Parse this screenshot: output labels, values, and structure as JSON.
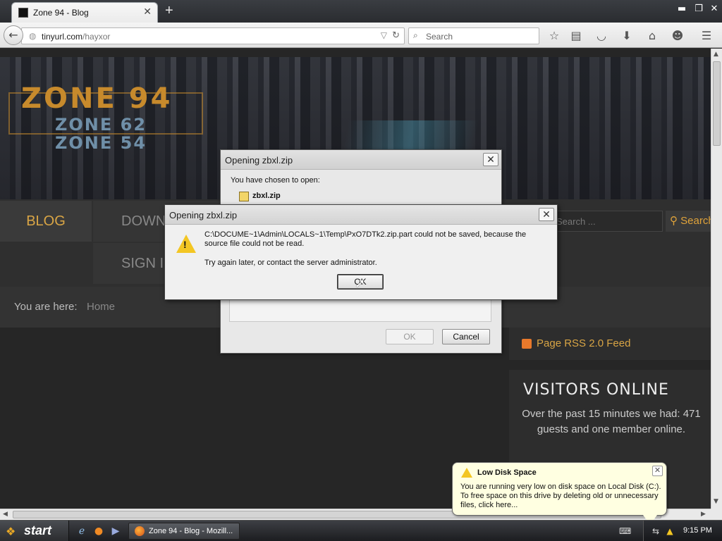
{
  "browser": {
    "tab_title": "Zone 94 - Blog",
    "tab_close": "✕",
    "new_tab": "+",
    "window_controls": {
      "minimize": "▬",
      "maximize": "❐",
      "close": "✕"
    },
    "back": "←",
    "url_host": "tinyurl.com",
    "url_path": "/hayxor",
    "search_placeholder": "Search",
    "toolbar_icons": [
      "star-icon",
      "reading-list-icon",
      "pocket-icon",
      "download-icon",
      "home-icon",
      "hello-icon",
      "menu-icon"
    ]
  },
  "site": {
    "logo_main": "ZONE 94",
    "logo_sub1": "ZONE 62",
    "logo_sub2": "ZONE 54",
    "menu": {
      "blog": "BLOG",
      "downloads": "DOWN",
      "signin": "SIGN IN"
    },
    "search_placeholder": "Search ...",
    "search_button": "Search",
    "breadcrumb_label": "You are here:",
    "breadcrumb_home": "Home",
    "rss_label": "Page RSS 2.0 Feed",
    "visitors_title": "VISITORS ONLINE",
    "visitors_text": "Over the past 15 minutes we had: 471 guests and one member online."
  },
  "dialog_back": {
    "title": "Opening zbxl.zip",
    "close": "✕",
    "chosen_text": "You have chosen to open:",
    "file_name": "zbxl.zip",
    "ok": "OK",
    "cancel": "Cancel"
  },
  "dialog_error": {
    "title": "Opening zbxl.zip",
    "close": "✕",
    "message": "C:\\DOCUME~1\\Admin\\LOCALS~1\\Temp\\PxO7DTk2.zip.part could not be saved, because the source file could not be read.",
    "hint": "Try again later, or contact the server administrator.",
    "ok": "OK"
  },
  "balloon": {
    "title": "Low Disk Space",
    "close": "✕",
    "text": "You are running very low on disk space on Local Disk (C:). To free space on this drive by deleting old or unnecessary files, click here..."
  },
  "taskbar": {
    "start": "start",
    "task_label": "Zone 94 - Blog - Mozill...",
    "clock": "9:15 PM"
  }
}
